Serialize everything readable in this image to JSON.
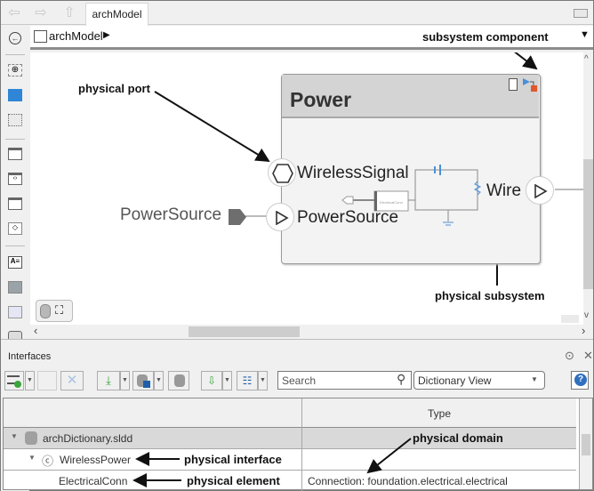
{
  "window": {
    "tab_label": "archModel",
    "nav": {
      "back_icon": "back-arrow-icon",
      "forward_icon": "forward-arrow-icon",
      "up_icon": "up-arrow-icon"
    },
    "keyboard_icon": "keyboard-icon"
  },
  "breadcrumb": {
    "model": "archModel",
    "arrow": "▶",
    "dropdown": "▼"
  },
  "palette": {
    "items": [
      "zoom-in",
      "fit-to-view",
      "fit-selection",
      "component",
      "reference-component",
      "variant-component",
      "adapter",
      "annotation",
      "image",
      "area",
      "screenshot"
    ]
  },
  "canvas": {
    "annotations": {
      "subsystem_component": "subsystem component",
      "physical_port": "physical port",
      "physical_subsystem": "physical subsystem"
    },
    "block": {
      "title": "Power",
      "ports": {
        "wireless": "WirelessSignal",
        "powersource": "PowerSource",
        "wire": "Wire"
      },
      "inner_element_label": "ElectricalConn"
    },
    "external_port": "PowerSource",
    "scroll": {
      "left": "‹",
      "right": "›",
      "up": "^",
      "down": "v"
    },
    "view_buttons": [
      "data-icon",
      "hierarchy-icon"
    ]
  },
  "interfaces": {
    "title": "Interfaces",
    "search_placeholder": "Search",
    "view_selection": "Dictionary View",
    "help": "?",
    "columns": [
      "",
      "Type"
    ],
    "rows": [
      {
        "name": "archDictionary.sldd",
        "type": "",
        "level": 0,
        "expanded": true
      },
      {
        "name": "WirelessPower",
        "type": "",
        "level": 1,
        "expanded": true
      },
      {
        "name": "ElectricalConn",
        "type": "Connection: foundation.electrical.electrical",
        "level": 2
      }
    ],
    "annotations": {
      "physical_domain": "physical domain",
      "physical_interface": "physical interface",
      "physical_element": "physical element"
    }
  },
  "colors": {
    "block_header": "#d4d4d4",
    "block_body": "#f3f3f3",
    "port_fill": "#6e6e6e",
    "selected_row": "#d9d9d9",
    "accent_blue": "#4a90d9",
    "accent_orange": "#e2572b"
  }
}
